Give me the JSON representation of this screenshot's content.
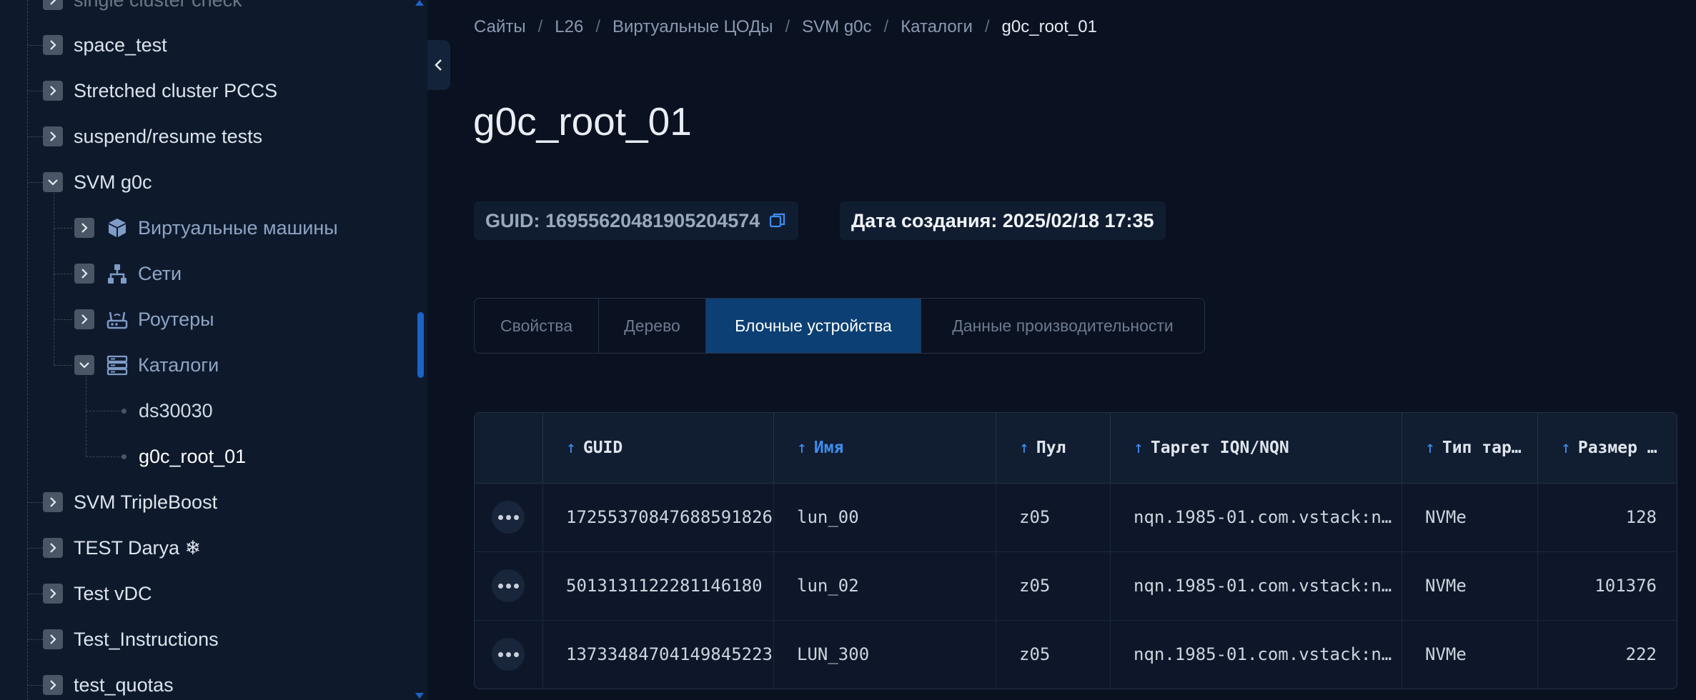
{
  "sidebar": {
    "items": [
      {
        "label": "single cluster check"
      },
      {
        "label": "space_test"
      },
      {
        "label": "Stretched cluster PCCS"
      },
      {
        "label": "suspend/resume tests"
      },
      {
        "label": "SVM g0c"
      },
      {
        "label": "Виртуальные машины",
        "icon": "cube-icon"
      },
      {
        "label": "Сети",
        "icon": "network-icon"
      },
      {
        "label": "Роутеры",
        "icon": "router-icon"
      },
      {
        "label": "Каталоги",
        "icon": "server-stack-icon"
      },
      {
        "label": "ds30030"
      },
      {
        "label": "g0c_root_01"
      },
      {
        "label": "SVM TripleBoost"
      },
      {
        "label": "TEST Darya ❄"
      },
      {
        "label": "Test vDC"
      },
      {
        "label": "Test_Instructions"
      },
      {
        "label": "test_quotas"
      }
    ]
  },
  "breadcrumb": [
    "Сайты",
    "L26",
    "Виртуальные ЦОДы",
    "SVM g0c",
    "Каталоги",
    "g0c_root_01"
  ],
  "page": {
    "title": "g0c_root_01",
    "guid_label": "GUID: 16955620481905204574",
    "created_label": "Дата создания: 2025/02/18 17:35"
  },
  "tabs": [
    "Свойства",
    "Дерево",
    "Блочные устройства",
    "Данные производительности"
  ],
  "active_tab": "Блочные устройства",
  "table": {
    "columns": [
      "GUID",
      "Имя",
      "Пул",
      "Таргет IQN/NQN",
      "Тип таргета",
      "Размер (ГБ)"
    ],
    "column_headers_visible": [
      "GUID",
      "Имя",
      "Пул",
      "Таргет IQN/NQN",
      "Тип тар…",
      "Размер …"
    ],
    "sorted_column": "Имя",
    "rows": [
      {
        "guid": "17255370847688591826",
        "name": "lun_00",
        "pool": "z05",
        "target": "nqn.1985-01.com.vstack:n…",
        "type": "NVMe",
        "size": "128"
      },
      {
        "guid": "5013131122281146180",
        "name": "lun_02",
        "pool": "z05",
        "target": "nqn.1985-01.com.vstack:n…",
        "type": "NVMe",
        "size": "101376"
      },
      {
        "guid": "13733484704149845223",
        "name": "LUN_300",
        "pool": "z05",
        "target": "nqn.1985-01.com.vstack:n…",
        "type": "NVMe",
        "size": "222"
      }
    ]
  },
  "colors": {
    "background": "#0a1120",
    "sidebar": "#0e1a2c",
    "accent": "#3d8ef0",
    "active_tab": "#0c3f73"
  }
}
